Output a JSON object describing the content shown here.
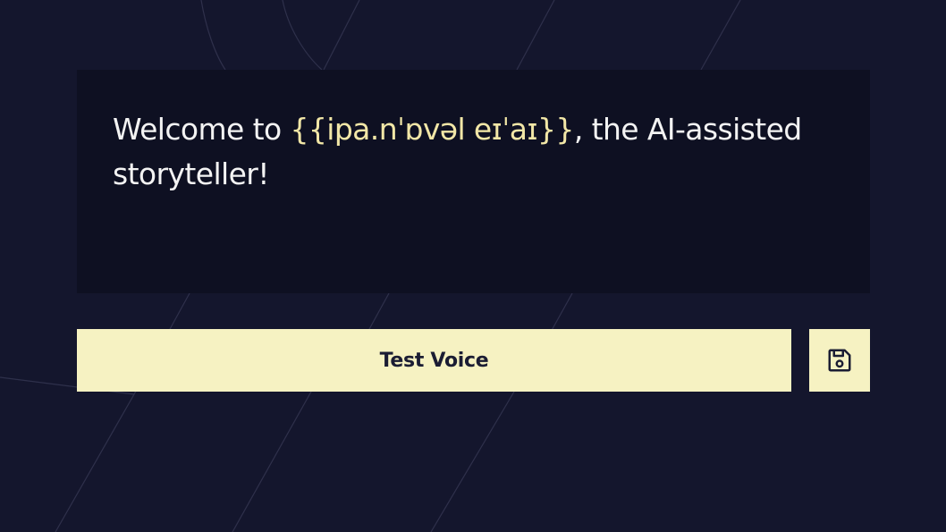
{
  "welcome": {
    "prefix": "Welcome to ",
    "highlight": "{{ipa.nˈɒvəl eɪˈaɪ}}",
    "suffix": ", the AI-assisted storyteller!"
  },
  "actions": {
    "test_voice_label": "Test Voice",
    "save_icon": "floppy-disk-icon"
  },
  "colors": {
    "background": "#14162d",
    "panel": "#0e1022",
    "text": "#f3f3f3",
    "highlight": "#f2e7a7",
    "button": "#f6f2c2",
    "button_text": "#1b1d33"
  }
}
